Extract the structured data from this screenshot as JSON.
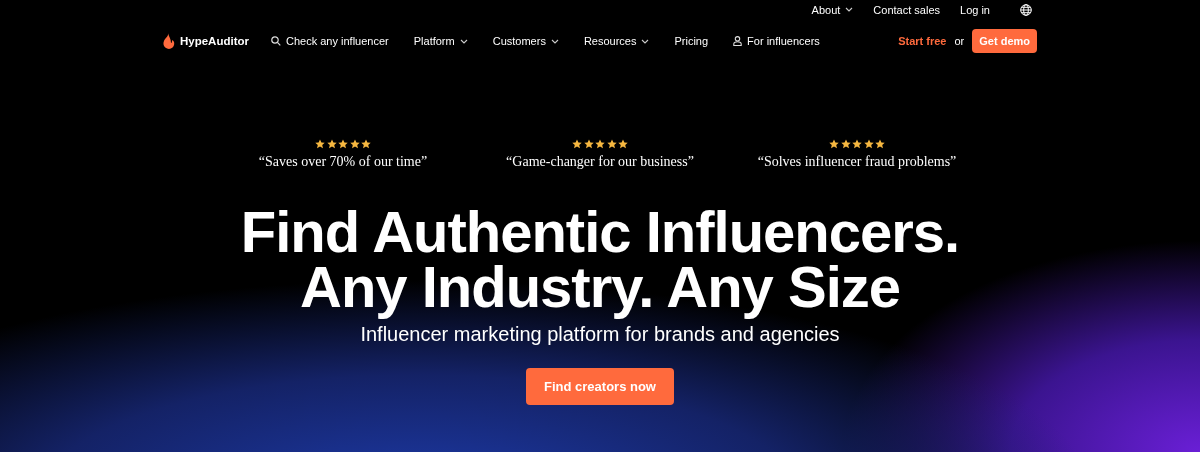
{
  "top_links": [
    {
      "label": "About",
      "kind": "dropdown"
    },
    {
      "label": "Contact sales",
      "kind": "link"
    },
    {
      "label": "Log in",
      "kind": "link"
    },
    {
      "kind": "globe"
    }
  ],
  "brand": "HypeAuditor",
  "nav": [
    {
      "label": "Check any influencer",
      "kind": "search"
    },
    {
      "label": "Platform",
      "kind": "dropdown"
    },
    {
      "label": "Customers",
      "kind": "dropdown"
    },
    {
      "label": "Resources",
      "kind": "dropdown"
    },
    {
      "label": "Pricing",
      "kind": "link"
    },
    {
      "label": "For influencers",
      "kind": "person"
    }
  ],
  "start_free": "Start free",
  "or": "or",
  "get_demo": "Get demo",
  "reviews": [
    {
      "stars": 5,
      "quote": "“Saves over 70% of our time”"
    },
    {
      "stars": 5,
      "quote": "“Game-changer for our business”"
    },
    {
      "stars": 5,
      "quote": "“Solves influencer fraud problems”"
    }
  ],
  "headline": [
    "Find Authentic Influencers.",
    "Any Industry. Any Size"
  ],
  "subtitle": "Influencer marketing platform for brands and agencies",
  "cta": "Find creators now"
}
